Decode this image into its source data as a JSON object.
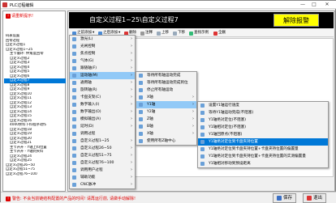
{
  "window": {
    "title": "PLC过程编辑",
    "minimize": "—",
    "maximize": "□",
    "close": "✕"
  },
  "left": {
    "warning": "请重新提示!",
    "tree": [
      {
        "label": "码表设置",
        "level": 0
      },
      {
        "label": "回零过程",
        "level": 0
      },
      {
        "label": "自定义过程1",
        "level": 0
      },
      {
        "label": "自定义过程1~25",
        "level": 0
      },
      {
        "label": "主卡循环: 伸角度回零",
        "level": 1
      },
      {
        "label": "自定义过程2",
        "level": 1
      },
      {
        "label": "自定义过程3",
        "level": 1
      },
      {
        "label": "自定义过程4",
        "level": 1
      },
      {
        "label": "自定义过程5",
        "level": 1
      },
      {
        "label": "自定义过程6",
        "level": 1
      },
      {
        "label": "自定义过程7",
        "level": 1,
        "selected": true
      },
      {
        "label": "自定义过程8",
        "level": 1
      },
      {
        "label": "自定义过程9",
        "level": 1
      },
      {
        "label": "自定义过程10",
        "level": 1
      },
      {
        "label": "自定义过程11",
        "level": 1
      },
      {
        "label": "自定义过程12",
        "level": 1
      },
      {
        "label": "自定义过程13",
        "level": 1
      },
      {
        "label": "自定义过程14",
        "level": 1
      },
      {
        "label": "自定义过程15",
        "level": 1
      },
      {
        "label": "自定义过程16",
        "level": 1
      },
      {
        "label": "4000余料下料程序动作",
        "level": 1
      },
      {
        "label": "自定义过程18",
        "level": 1
      },
      {
        "label": "自定义过程19",
        "level": 1
      },
      {
        "label": "自定义过程20",
        "level": 1
      },
      {
        "label": "自定义过程21",
        "level": 1
      },
      {
        "label": "主卡开升 - Y轴上料位置",
        "level": 1
      },
      {
        "label": "主卡开升 - Y轴到夹料",
        "level": 1
      },
      {
        "label": "自定义过程24",
        "level": 1
      },
      {
        "label": "自定义过程25",
        "level": 1
      },
      {
        "label": "自定义过程26~50",
        "level": 0
      },
      {
        "label": "自定义过程51~75",
        "level": 0
      },
      {
        "label": "自定义过程76~100",
        "level": 0
      }
    ]
  },
  "main": {
    "banner": "自定义过程1~25\\自定义过程7",
    "alarm_button": "解除报警",
    "toolbar": {
      "add_before": "之前添加",
      "add_after": "之后添加",
      "delete": "删除",
      "comment": "注释",
      "move_up": "上移",
      "move_down": "下移",
      "view_example": "查找示例",
      "delete_all": "全删"
    }
  },
  "menu1": [
    "激光(L)",
    "光闸控制",
    "焦点控制",
    "气体(G)",
    "跟随轴(F)",
    "运动轴(M)",
    "通用轴",
    "旋转轴(R)",
    "卡盘支架(C)",
    "数字输入(I)",
    "数字输出(O)",
    "模拟输出(A)",
    "延时(D)",
    "调用过程",
    "自定义过程1~25",
    "自定义过程26~50",
    "自定义过程51~75",
    "自定义过程76~100",
    "调用用户过程",
    "辅助功能",
    "CNC脉冲"
  ],
  "menu2": [
    "等待所有轴运动完成",
    "等待所有轴运动完成到位",
    "停止所有轴运动",
    "X轴",
    "Y1轴",
    "Y2轴",
    "Z轴",
    "B轴",
    "X轴",
    "使用所有Z轴中心"
  ],
  "menu3": [
    "设置Y1轴运行速度",
    "等待Y1轴运动完成(不阻塞)",
    "Y1轴绝对定位(不阻塞)",
    "Y1轴相对定位(不阻塞)",
    "Y1轴回原点(不阻塞)",
    "Y1轴绝对定位到卡盘夹持位置",
    "Y1轴绝对定位到卡盘夹持位置+卡盘夹持位置的偏置量",
    "Y1轴绝对定位到卡盘夹持位置+卡盘夹持位置的实测偏置量",
    "Y1轴相对移动到预设距离"
  ],
  "status": {
    "message": "警告: 不会当前链结构配置的产品的时间! 请再运行前, 请做手动解除!",
    "save": "保存",
    "exit": "退出"
  }
}
